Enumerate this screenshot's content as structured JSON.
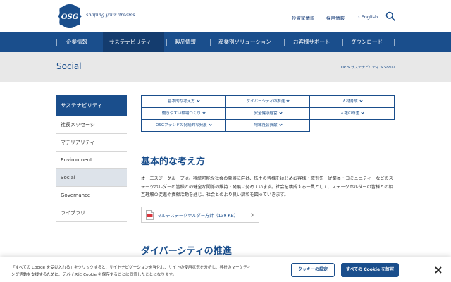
{
  "header": {
    "logo_text": "OSG",
    "tagline": "shaping your dreams",
    "links": {
      "ir": "投資家情報",
      "recruit": "採用情報",
      "english": "English"
    }
  },
  "nav": {
    "items": [
      {
        "label": "企業情報"
      },
      {
        "label": "サステナビリティ",
        "active": true
      },
      {
        "label": "製品情報"
      },
      {
        "label": "産業別ソリューション"
      },
      {
        "label": "お客様サポート"
      },
      {
        "label": "ダウンロード"
      }
    ]
  },
  "page": {
    "title": "Social",
    "breadcrumb": {
      "home": "TOP",
      "sep1": ">",
      "parent": "サステナビリティ",
      "sep2": ">",
      "current": "Social"
    }
  },
  "sidebar": {
    "heading": "サステナビリティ",
    "items": [
      {
        "label": "社長メッセージ"
      },
      {
        "label": "マテリアリティ"
      },
      {
        "label": "Environment"
      },
      {
        "label": "Social",
        "active": true
      },
      {
        "label": "Governance"
      },
      {
        "label": "ライブラリ"
      }
    ]
  },
  "anchors": [
    "基本的な考え方",
    "ダイバーシティの推進",
    "人材育成",
    "働きやすい職場づくり",
    "安全健康経営",
    "人権の尊重",
    "OSGブランドの持続的な発展",
    "地域社会貢献"
  ],
  "content": {
    "section1_title": "基本的な考え方",
    "paragraph": "オーエスジーグループは、持続可能な社会の発展に向け、株主の皆様をはじめお客様・取引先・従業員・コミュニティーなどのステークホルダーの皆様との健全な関係の維持・発展に努めています。社会を構成する一員として、ステークホルダーの皆様との相互理解の促進や貢献活動を通じ、社会とのより良い調和を図っていきます。",
    "pdf_label": "マルチステークホルダー方針（139 KB）",
    "section2_title": "ダイバーシティの推進"
  },
  "cookie": {
    "text": "「すべての Cookie を受け入れる」をクリックすると、サイトナビゲーションを強化し、サイトの使用状況を分析し、弊社のマーケティング活動を支援するために、デバイスに Cookie を保存することに同意したことになります。",
    "settings_label": "クッキーの設定",
    "accept_label": "すべての Cookie を許可"
  },
  "colors": {
    "brand": "#1a4e8c",
    "nav_active": "#143c6e",
    "band": "#e8e8e8",
    "pdf_red": "#d9363e"
  }
}
